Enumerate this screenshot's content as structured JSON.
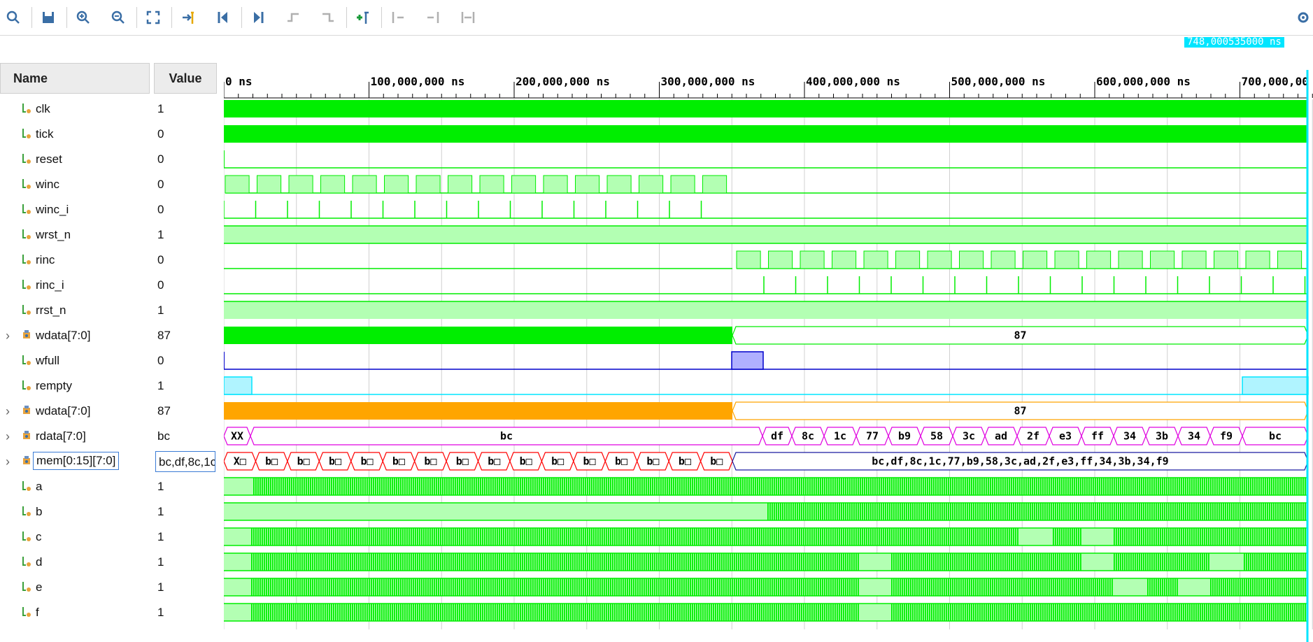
{
  "toolbar": {
    "buttons": [
      {
        "name": "search-icon",
        "glyph": "search"
      },
      {
        "name": "save-icon",
        "glyph": "save"
      },
      {
        "name": "zoom-in-icon",
        "glyph": "zoom-in"
      },
      {
        "name": "zoom-out-icon",
        "glyph": "zoom-out"
      },
      {
        "name": "zoom-fit-icon",
        "glyph": "fit"
      },
      {
        "name": "go-to-cursor-icon",
        "glyph": "cursor"
      },
      {
        "name": "go-to-time-zero-icon",
        "glyph": "first"
      },
      {
        "name": "go-to-last-time-icon",
        "glyph": "last"
      },
      {
        "name": "previous-transition-icon",
        "glyph": "prev-edge"
      },
      {
        "name": "next-transition-icon",
        "glyph": "next-edge"
      },
      {
        "name": "add-marker-icon",
        "glyph": "add-marker"
      },
      {
        "name": "previous-marker-icon",
        "glyph": "prev-marker"
      },
      {
        "name": "next-marker-icon",
        "glyph": "next-marker"
      },
      {
        "name": "swap-cursors-icon",
        "glyph": "swap"
      }
    ],
    "settings_icon": "gear-icon"
  },
  "cursor_time": "748,000535000 ns",
  "columns": {
    "name": "Name",
    "value": "Value"
  },
  "ruler": {
    "labels": [
      "0 ns",
      "100,000,000 ns",
      "200,000,000 ns",
      "300,000,000 ns",
      "400,000,000 ns",
      "500,000,000 ns",
      "600,000,000 ns",
      "700,000,00"
    ]
  },
  "colors": {
    "green": "#00ee00",
    "lightgreen": "#b3ffb3",
    "orange": "#ffa500",
    "magenta": "#e000e0",
    "red": "#ff0000",
    "blue": "#0000cc",
    "cyan": "#00e5ff",
    "navy": "#1a1aa0",
    "grid": "#d0d0d0"
  },
  "signals": [
    {
      "name": "clk",
      "value": "1",
      "icon": "wire",
      "expandable": false
    },
    {
      "name": "tick",
      "value": "0",
      "icon": "wire",
      "expandable": false
    },
    {
      "name": "reset",
      "value": "0",
      "icon": "wire",
      "expandable": false
    },
    {
      "name": "winc",
      "value": "0",
      "icon": "wire",
      "expandable": false
    },
    {
      "name": "winc_i",
      "value": "0",
      "icon": "wire",
      "expandable": false
    },
    {
      "name": "wrst_n",
      "value": "1",
      "icon": "wire",
      "expandable": false
    },
    {
      "name": "rinc",
      "value": "0",
      "icon": "wire",
      "expandable": false
    },
    {
      "name": "rinc_i",
      "value": "0",
      "icon": "wire",
      "expandable": false
    },
    {
      "name": "rrst_n",
      "value": "1",
      "icon": "wire",
      "expandable": false
    },
    {
      "name": "wdata[7:0]",
      "value": "87",
      "icon": "bus",
      "expandable": true
    },
    {
      "name": "wfull",
      "value": "0",
      "icon": "wire",
      "expandable": false
    },
    {
      "name": "rempty",
      "value": "1",
      "icon": "wire",
      "expandable": false
    },
    {
      "name": "wdata[7:0]",
      "value": "87",
      "icon": "bus",
      "expandable": true
    },
    {
      "name": "rdata[7:0]",
      "value": "bc",
      "icon": "bus",
      "expandable": true
    },
    {
      "name": "mem[0:15][7:0]",
      "value": "bc,df,8c,1c",
      "icon": "bus",
      "expandable": true,
      "selected": true
    },
    {
      "name": "a",
      "value": "1",
      "icon": "wire",
      "expandable": false
    },
    {
      "name": "b",
      "value": "1",
      "icon": "wire",
      "expandable": false
    },
    {
      "name": "c",
      "value": "1",
      "icon": "wire",
      "expandable": false
    },
    {
      "name": "d",
      "value": "1",
      "icon": "wire",
      "expandable": false
    },
    {
      "name": "e",
      "value": "1",
      "icon": "wire",
      "expandable": false
    },
    {
      "name": "f",
      "value": "1",
      "icon": "wire",
      "expandable": false
    }
  ],
  "bus_labels": {
    "wdata1": "87",
    "wdata2": "87",
    "rdata": [
      "XX",
      "bc",
      "df",
      "8c",
      "1c",
      "77",
      "b9",
      "58",
      "3c",
      "ad",
      "2f",
      "e3",
      "ff",
      "34",
      "3b",
      "34",
      "f9",
      "bc"
    ],
    "mem_early": [
      "X□",
      "b□",
      "b□",
      "b□",
      "b□",
      "b□",
      "b□",
      "b□",
      "b□",
      "b□",
      "b□",
      "b□",
      "b□",
      "b□",
      "b□",
      "b□"
    ],
    "mem_late": "bc,df,8c,1c,77,b9,58,3c,ad,2f,e3,ff,34,3b,34,f9"
  }
}
